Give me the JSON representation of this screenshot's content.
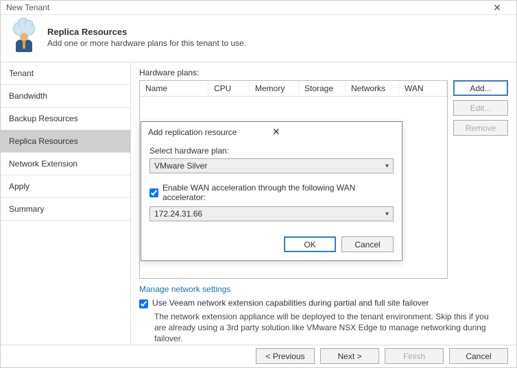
{
  "window": {
    "title": "New Tenant"
  },
  "header": {
    "title": "Replica Resources",
    "subtitle": "Add one or more hardware plans for this tenant to use."
  },
  "sidebar": {
    "items": [
      {
        "label": "Tenant"
      },
      {
        "label": "Bandwidth"
      },
      {
        "label": "Backup Resources"
      },
      {
        "label": "Replica Resources"
      },
      {
        "label": "Network Extension"
      },
      {
        "label": "Apply"
      },
      {
        "label": "Summary"
      }
    ]
  },
  "main": {
    "hw_label": "Hardware plans:",
    "columns": {
      "name": "Name",
      "cpu": "CPU",
      "memory": "Memory",
      "storage": "Storage",
      "networks": "Networks",
      "wan": "WAN"
    },
    "buttons": {
      "add": "Add...",
      "edit": "Edit...",
      "remove": "Remove"
    },
    "link": "Manage network settings",
    "checkbox_label": "Use Veeam network extension capabilities during partial and full site failover",
    "note": "The network extension appliance will be deployed to the tenant environment. Skip this if you are already using a 3rd party solution like VMware NSX Edge to manage networking during failover."
  },
  "dialog": {
    "title": "Add replication resource",
    "select_label": "Select hardware plan:",
    "plan_value": "VMware Silver",
    "wan_checkbox": "Enable WAN acceleration through the following WAN accelerator:",
    "wan_value": "172.24.31.66",
    "ok": "OK",
    "cancel": "Cancel"
  },
  "footer": {
    "previous": "< Previous",
    "next": "Next >",
    "finish": "Finish",
    "cancel": "Cancel"
  }
}
